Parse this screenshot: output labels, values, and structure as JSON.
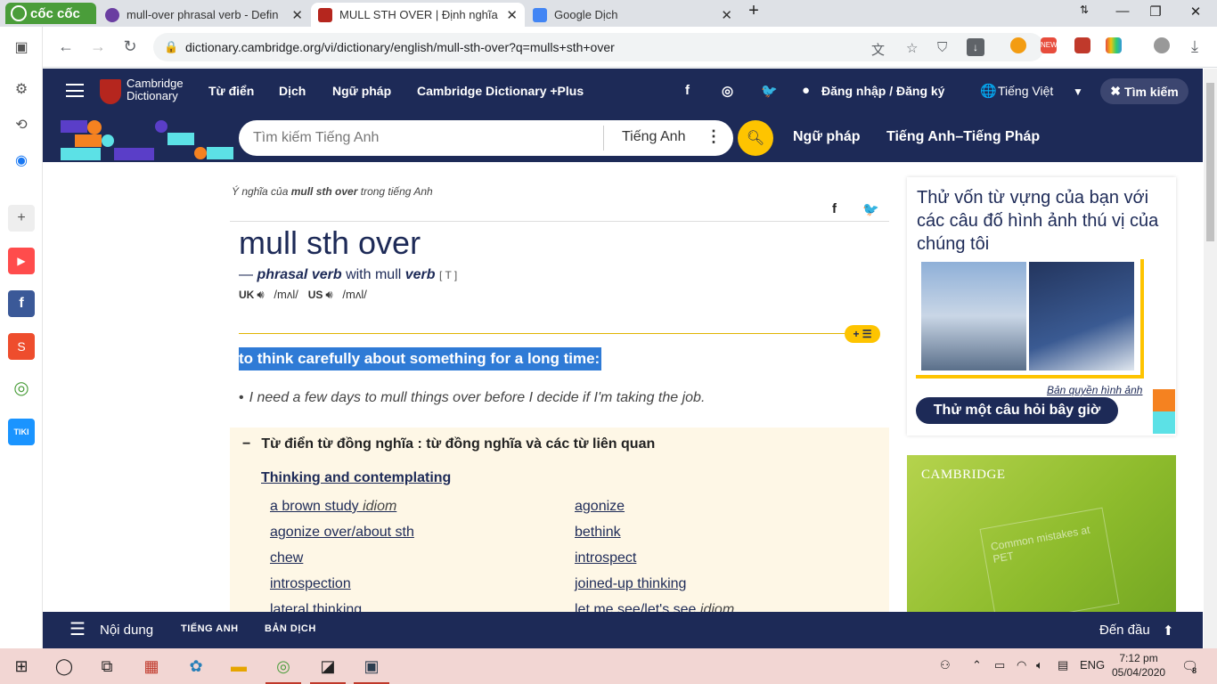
{
  "browser": {
    "brand": "cốc cốc",
    "tabs": [
      {
        "title": "mull-over phrasal verb - Defin",
        "favicon_color": "#6a3ea1",
        "active": false
      },
      {
        "title": "MULL STH OVER | Định nghĩa",
        "favicon_color": "#b5261e",
        "active": true
      },
      {
        "title": "Google Dịch",
        "favicon_color": "#4285f4",
        "active": false
      }
    ],
    "new_tab": "+",
    "url": "dictionary.cambridge.org/vi/dictionary/english/mull-sth-over?q=mulls+sth+over"
  },
  "site_nav": {
    "logo_line1": "Cambridge",
    "logo_line2": "Dictionary",
    "links": [
      "Từ điển",
      "Dịch",
      "Ngữ pháp",
      "Cambridge Dictionary +Plus"
    ],
    "login": "Đăng nhập / Đăng ký",
    "language": "Tiếng Việt",
    "search_pill": "Tìm kiếm"
  },
  "search_bar": {
    "placeholder": "Tìm kiếm Tiếng Anh",
    "dictionary": "Tiếng Anh",
    "links": [
      "Ngữ pháp",
      "Tiếng Anh–Tiếng Pháp"
    ]
  },
  "entry": {
    "crumb_pre": "Ý nghĩa của ",
    "crumb_word": "mull sth over",
    "crumb_post": " trong tiếng Anh",
    "headword": "mull sth over",
    "dash": "—",
    "pos": "phrasal verb",
    "with": "with mull",
    "verb": "verb",
    "grammar": "[ T ]",
    "uk_label": "UK",
    "uk_ipa": "/mʌl/",
    "us_label": "US",
    "us_ipa": "/mʌl/",
    "pill": "+ ☰",
    "definition": "to think carefully about something for a long time:",
    "example": "I need a few days to mull things over before I decide if I'm taking the job."
  },
  "thesaurus": {
    "toggle": "−",
    "heading": "Từ điển từ đồng nghĩa : từ đồng nghĩa và các từ liên quan",
    "section": "Thinking and contemplating",
    "left": [
      {
        "word": "a brown study",
        "tag": "idiom"
      },
      {
        "word": "agonize over/about sth",
        "tag": ""
      },
      {
        "word": "chew",
        "tag": ""
      },
      {
        "word": "introspection",
        "tag": ""
      },
      {
        "word": "lateral thinking",
        "tag": ""
      }
    ],
    "right": [
      {
        "word": "agonize",
        "tag": ""
      },
      {
        "word": "bethink",
        "tag": ""
      },
      {
        "word": "introspect",
        "tag": ""
      },
      {
        "word": "joined-up thinking",
        "tag": ""
      },
      {
        "word": "let me see/let's see",
        "tag": "idiom"
      }
    ]
  },
  "quiz_ad": {
    "title": "Thử vốn từ vựng của bạn với các câu đố hình ảnh thú vị của chúng tôi",
    "copyright": "Bản quyền hình ảnh",
    "button": "Thử một câu hỏi bây giờ"
  },
  "book_ad": {
    "brand": "CAMBRIDGE",
    "book_title": "Common mistakes at PET"
  },
  "bottom_bar": {
    "contents": "Nội dung",
    "english": "TIẾNG ANH",
    "translation": "BẢN DỊCH",
    "to_top": "Đến đầu"
  },
  "taskbar": {
    "language": "ENG",
    "time": "7:12 pm",
    "date": "05/04/2020",
    "notifications": "8"
  },
  "colors": {
    "navy": "#1d2a57",
    "yellow": "#fec400",
    "highlight": "#2f7bd6",
    "thesaurus_bg": "#fef7e6",
    "taskbar": "#f2d6d3"
  }
}
